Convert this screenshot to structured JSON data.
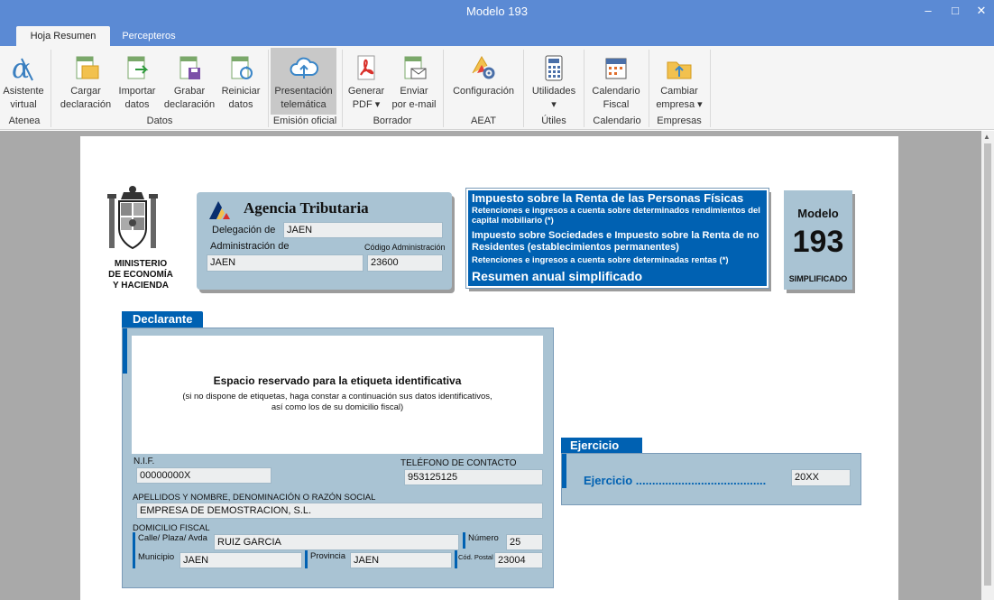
{
  "window": {
    "title": "Modelo 193"
  },
  "tabs": [
    {
      "label": "Hoja Resumen"
    },
    {
      "label": "Percepteros"
    }
  ],
  "ribbon": {
    "buttons": [
      {
        "label": "Asistente\nvirtual"
      },
      {
        "label": "Cargar\ndeclaración"
      },
      {
        "label": "Importar\ndatos"
      },
      {
        "label": "Grabar\ndeclaración"
      },
      {
        "label": "Reiniciar\ndatos"
      },
      {
        "label": "Presentación\ntelemática"
      },
      {
        "label": "Generar\nPDF ▾"
      },
      {
        "label": "Enviar\npor e-mail"
      },
      {
        "label": "Configuración"
      },
      {
        "label": "Utilidades\n▾"
      },
      {
        "label": "Calendario\nFiscal"
      },
      {
        "label": "Cambiar\nempresa ▾"
      }
    ],
    "groups": [
      {
        "label": "Atenea"
      },
      {
        "label": "Datos"
      },
      {
        "label": "Emisión oficial"
      },
      {
        "label": "Borrador"
      },
      {
        "label": "AEAT"
      },
      {
        "label": "Útiles"
      },
      {
        "label": "Calendario"
      },
      {
        "label": "Empresas"
      }
    ]
  },
  "form": {
    "ministry": {
      "line1": "MINISTERIO",
      "line2": "DE ECONOMÍA",
      "line3": "Y HACIENDA"
    },
    "agency": {
      "name": "Agencia Tributaria",
      "delegacion_label": "Delegación de",
      "delegacion_value": "JAEN",
      "administracion_label": "Administración de",
      "administracion_value": "JAEN",
      "codigo_label": "Código Administración",
      "codigo_value": "23600"
    },
    "header": {
      "t1": "Impuesto sobre la Renta de las Personas Físicas",
      "t2": "Retenciones e ingresos a cuenta sobre determinados rendimientos del capital mobiliario (*)",
      "t3": "Impuesto sobre Sociedades e Impuesto sobre la Renta de no Residentes (establecimientos permanentes)",
      "t4": "Retenciones e ingresos a cuenta sobre determinadas rentas (*)",
      "t5": "Resumen anual simplificado"
    },
    "modelo": {
      "label": "Modelo",
      "number": "193",
      "sub": "SIMPLIFICADO"
    },
    "declarante": {
      "title": "Declarante",
      "label_title": "Espacio reservado para la etiqueta identificativa",
      "label_sub1": "(si no dispone de etiquetas, haga constar a continuación sus datos identificativos,",
      "label_sub2": "así como los de su domicilio fiscal)",
      "nif_label": "N.I.F.",
      "nif_value": "00000000X",
      "tel_label": "TELÉFONO DE CONTACTO",
      "tel_value": "953125125",
      "nombre_label": "APELLIDOS Y NOMBRE, DENOMINACIÓN O RAZÓN SOCIAL",
      "nombre_value": "EMPRESA DE DEMOSTRACION, S.L.",
      "domicilio_label": "DOMICILIO FISCAL",
      "calle_label": "Calle/ Plaza/ Avda",
      "calle_value": "RUIZ GARCIA",
      "numero_label": "Número",
      "numero_value": "25",
      "municipio_label": "Municipio",
      "municipio_value": "JAEN",
      "provincia_label": "Provincia",
      "provincia_value": "JAEN",
      "cp_label": "Cód. Postal",
      "cp_value": "23004"
    },
    "ejercicio": {
      "title": "Ejercicio",
      "label": "Ejercicio ........................................",
      "value": "20XX"
    }
  },
  "colors": {
    "titlebar": "#5b8ad4",
    "panel": "#a9c3d3",
    "accent_blue": "#0061b2"
  }
}
